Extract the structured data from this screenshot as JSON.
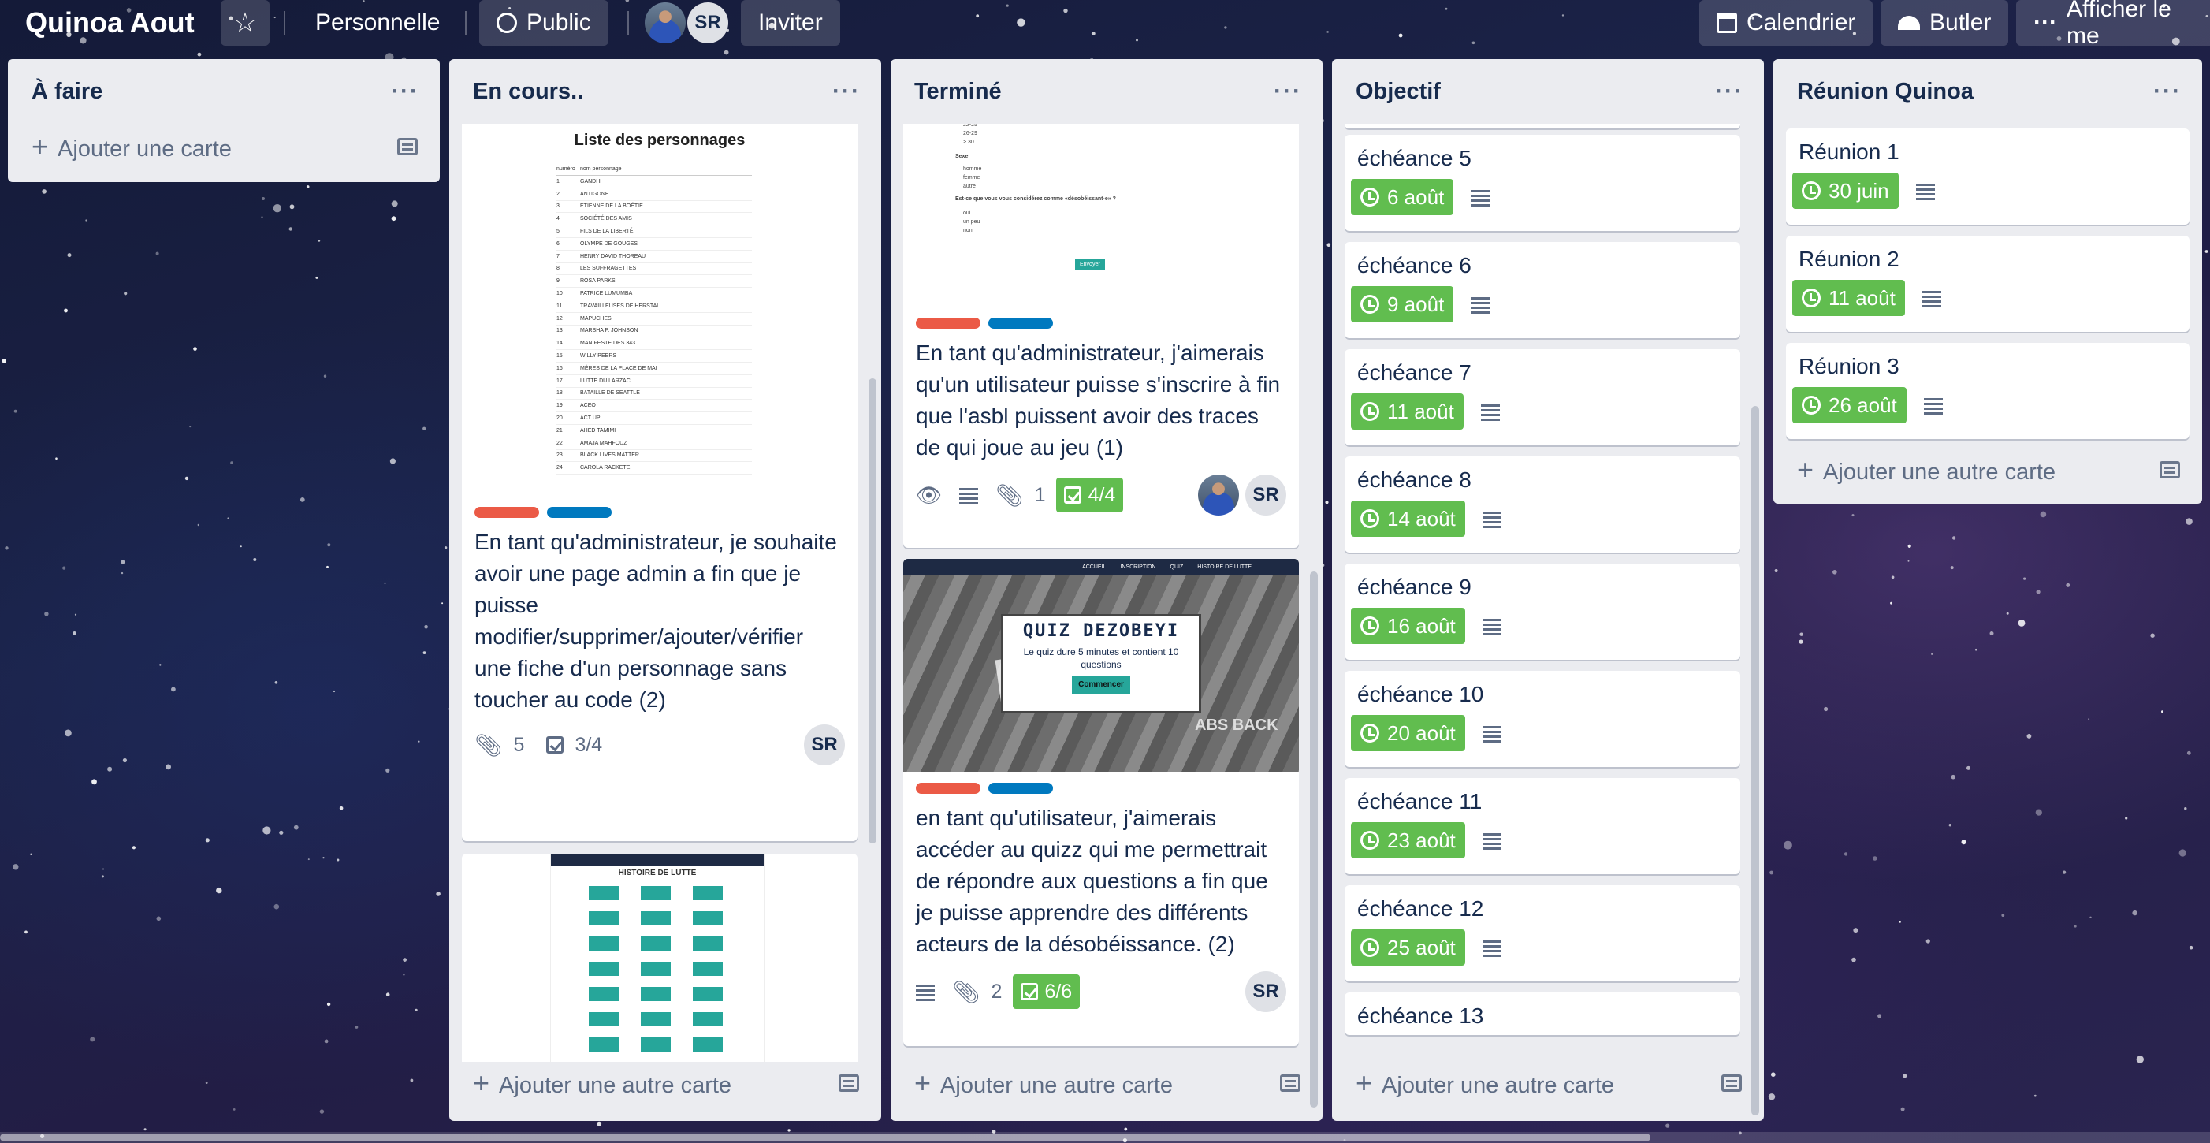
{
  "board": {
    "title": "Quinoa Aout",
    "visibility_workspace": "Personnelle",
    "visibility": "Public",
    "invite": "Inviter",
    "avatar_initials": "SR",
    "right_buttons": {
      "calendar": "Calendrier",
      "butler": "Butler",
      "menu": "Afficher le me"
    }
  },
  "colors": {
    "label_red": "#eb5a46",
    "label_blue": "#0079bf",
    "due_green": "#61bd4f",
    "list_bg": "#ebecf0"
  },
  "lists": [
    {
      "name": "À faire",
      "add": "Ajouter une carte"
    },
    {
      "name": "En cours..",
      "add": "Ajouter une autre carte",
      "cards": [
        {
          "cover_title": "Liste des personnages",
          "cover_col1": "numéro",
          "cover_col2": "nom personnage",
          "rows": [
            "GANDHI",
            "ANTIGONE",
            "ETIENNE DE LA BOÉTIE",
            "SOCIÉTÉ DES AMIS",
            "FILS DE LA LIBERTÉ",
            "OLYMPE DE GOUGES",
            "HENRY DAVID THOREAU",
            "LES SUFFRAGETTES",
            "ROSA PARKS",
            "PATRICE LUMUMBA",
            "TRAVAILLEUSES DE HERSTAL",
            "MAPUCHES",
            "MARSHA P. JOHNSON",
            "MANIFESTE DES 343",
            "WILLY PEERS",
            "MÈRES DE LA PLACE DE MAI",
            "LUTTE DU LARZAC",
            "BATAILLE DE SEATTLE",
            "ACEO",
            "ACT UP",
            "AHED TAMIMI",
            "AMAJA MAHFOUZ",
            "BLACK LIVES MATTER",
            "CAROLA RACKETE"
          ],
          "title": "En tant qu'administrateur, je souhaite avoir une page admin a fin que je puisse modifier/supprimer/ajouter/vérifier une fiche d'un personnage sans toucher au code (2)",
          "attachments": "5",
          "checklist": "3/4",
          "member": "SR"
        },
        {
          "cover_title": "HISTOIRE DE LUTTE"
        }
      ]
    },
    {
      "name": "Terminé",
      "add": "Ajouter une autre carte",
      "cards": [
        {
          "form_q1": "Sexe",
          "form_opts1": [
            "homme",
            "femme",
            "autre"
          ],
          "form_q2": "Est-ce que vous vous considérez comme «désobéissant-e» ?",
          "form_opts2": [
            "oui",
            "un peu",
            "non"
          ],
          "form_ages": [
            "22-25",
            "26-29",
            "> 30"
          ],
          "form_btn": "Envoyer",
          "title": "En tant qu'administrateur, j'aimerais qu'un utilisateur puisse s'inscrire à fin que l'asbl puissent avoir des traces de qui joue au jeu (1)",
          "attachments": "1",
          "checklist": "4/4",
          "member": "SR"
        },
        {
          "nav": [
            "ACCUEIL",
            "INSCRIPTION",
            "QUIZ",
            "HISTOIRE DE LUTTE"
          ],
          "quiz_title": "QUIZ DEZOBEYI",
          "quiz_sub": "Le quiz dure 5 minutes et contient 10 questions",
          "quiz_btn": "Commencer",
          "sign": "ABS BACK",
          "title": "en tant qu'utilisateur, j'aimerais accéder au quizz qui me permettrait de répondre aux questions a fin que je puisse apprendre des différents acteurs de la désobéissance. (2)",
          "attachments": "2",
          "checklist": "6/6",
          "member": "SR"
        }
      ]
    },
    {
      "name": "Objectif",
      "add": "Ajouter une autre carte",
      "cards": [
        {
          "title": "échéance 5",
          "due": "6 août"
        },
        {
          "title": "échéance 6",
          "due": "9 août"
        },
        {
          "title": "échéance 7",
          "due": "11 août"
        },
        {
          "title": "échéance 8",
          "due": "14 août"
        },
        {
          "title": "échéance 9",
          "due": "16 août"
        },
        {
          "title": "échéance 10",
          "due": "20 août"
        },
        {
          "title": "échéance 11",
          "due": "23 août"
        },
        {
          "title": "échéance 12",
          "due": "25 août"
        },
        {
          "title": "échéance 13"
        }
      ]
    },
    {
      "name": "Réunion Quinoa",
      "add": "Ajouter une autre carte",
      "cards": [
        {
          "title": "Réunion 1",
          "due": "30 juin"
        },
        {
          "title": "Réunion 2",
          "due": "11 août"
        },
        {
          "title": "Réunion 3",
          "due": "26 août"
        }
      ]
    }
  ]
}
